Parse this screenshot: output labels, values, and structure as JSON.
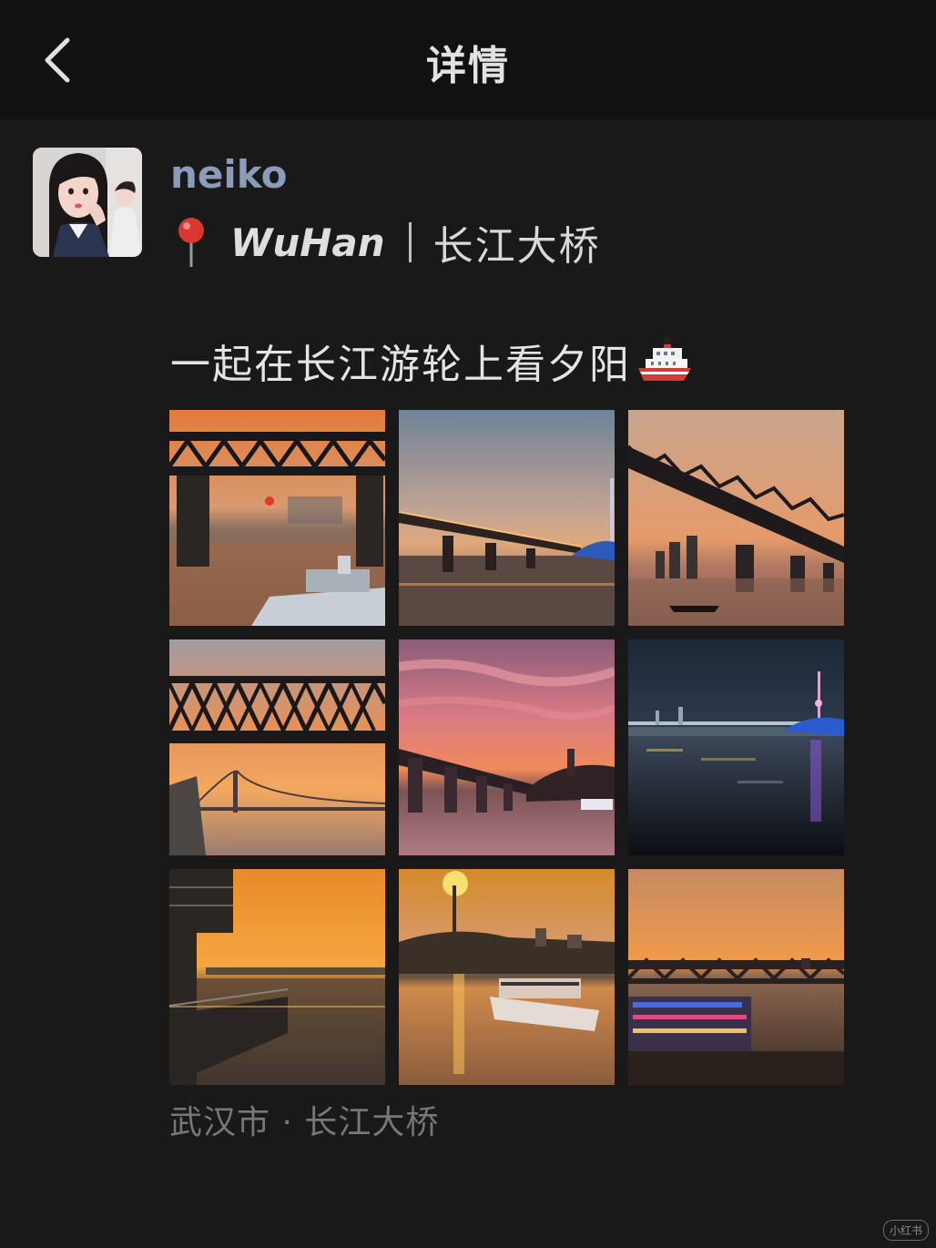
{
  "navbar": {
    "title": "详情",
    "back_icon": "chevron-left-icon"
  },
  "post": {
    "username": "neiko",
    "location_en": "WuHan",
    "location_zh": "长江大桥",
    "location_icon": "red-pin-icon",
    "caption": "一起在长江游轮上看夕阳",
    "caption_emoji": "ship-icon",
    "place": "武汉市 · 长江大桥",
    "photos": [
      {
        "subject": "bridge truss at sunset with cruise ship"
      },
      {
        "subject": "bridge and lit tower at dusk"
      },
      {
        "subject": "bridge silhouette with small boat"
      },
      {
        "subject": "bridge truss over suspension bridge sunset"
      },
      {
        "subject": "pink sky over bridge"
      },
      {
        "subject": "night skyline with purple lit tower"
      },
      {
        "subject": "pier at golden sunset"
      },
      {
        "subject": "tower sunset with ferry"
      },
      {
        "subject": "bridge with illuminated cruise ship"
      }
    ]
  },
  "watermark": "小红书",
  "colors": {
    "background": "#191919",
    "navbar": "#111111",
    "username": "#8a9cba",
    "place": "#777777"
  }
}
